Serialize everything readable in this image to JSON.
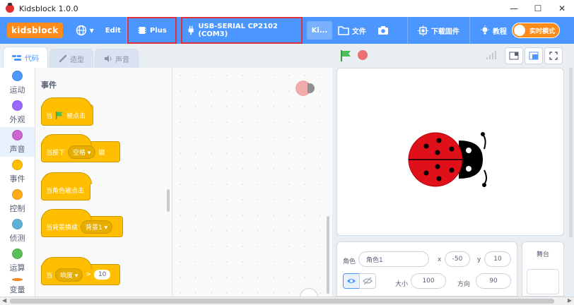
{
  "window": {
    "title": "Kidsblock 1.0.0",
    "controls": [
      "—",
      "☐",
      "✕"
    ]
  },
  "menubar": {
    "logo": "kidsblock",
    "edit": "Edit",
    "plus": "Plus",
    "serial": "USB-SERIAL CP2102 (COM3)",
    "ki_tab": "Ki...",
    "file": "文件",
    "download": "下载固件",
    "tutorial": "教程",
    "realtime": "实时模式",
    "colors": {
      "bar": "#4c97ff",
      "logo": "#ff8c1a",
      "highlight": "#e0303c"
    }
  },
  "tabs": [
    {
      "label": "代码",
      "icon": "code-icon",
      "active": true
    },
    {
      "label": "造型",
      "icon": "brush-icon",
      "active": false
    },
    {
      "label": "声音",
      "icon": "speaker-icon",
      "active": false
    }
  ],
  "categories": [
    {
      "label": "运动",
      "color": "#4c97ff"
    },
    {
      "label": "外观",
      "color": "#9966ff"
    },
    {
      "label": "声音",
      "color": "#cf63cf"
    },
    {
      "label": "事件",
      "color": "#ffbf00"
    },
    {
      "label": "控制",
      "color": "#ffab19"
    },
    {
      "label": "侦测",
      "color": "#5cb1d6"
    },
    {
      "label": "运算",
      "color": "#59c059"
    },
    {
      "label": "变量",
      "color": "#ff8c1a"
    }
  ],
  "palette": {
    "title": "事件",
    "blocks": {
      "flag_clicked": {
        "pre": "当",
        "post": "被点击"
      },
      "key_pressed": {
        "pre": "当按下",
        "key": "空格 ▾",
        "post": "键"
      },
      "sprite_clicked": {
        "text": "当角色被点击"
      },
      "backdrop_switch": {
        "pre": "当背景换成",
        "backdrop": "背景1 ▾"
      },
      "when_greater": {
        "pre": "当",
        "sensor": "响度 ▾",
        "op": ">",
        "value": "10"
      }
    }
  },
  "sprite_info": {
    "sprite_label": "角色",
    "sprite_name": "角色1",
    "x_label": "x",
    "x": "-50",
    "y_label": "y",
    "y": "10",
    "size_label": "大小",
    "size": "100",
    "direction_label": "方向",
    "direction": "90"
  },
  "stage_panel": {
    "label": "舞台"
  }
}
